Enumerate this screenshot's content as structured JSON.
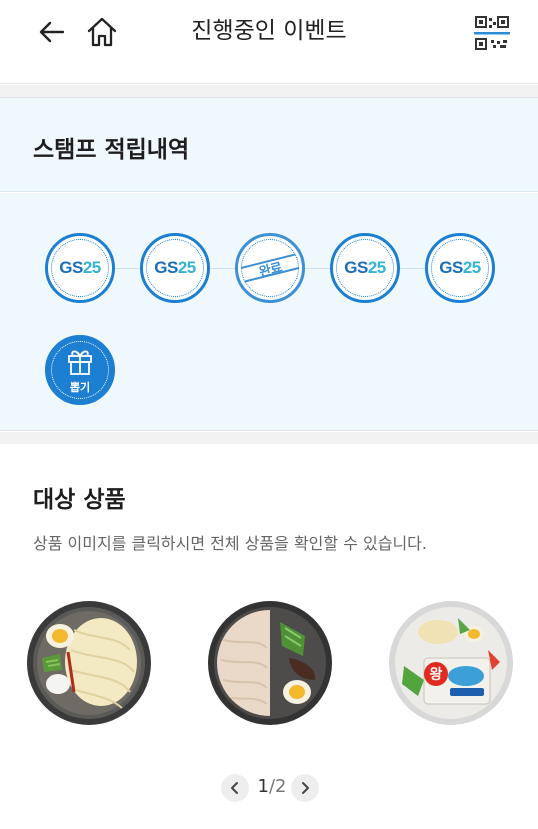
{
  "header": {
    "title": "진행중인 이벤트"
  },
  "stamp_section": {
    "title": "스탬프 적립내역",
    "stamps": [
      {
        "gs": "GS",
        "num": "25"
      },
      {
        "gs": "GS",
        "num": "25"
      },
      {
        "done_label": "완료"
      },
      {
        "gs": "GS",
        "num": "25"
      },
      {
        "gs": "GS",
        "num": "25"
      }
    ],
    "gift_label": "뽑기"
  },
  "products_section": {
    "title": "대상 상품",
    "description": "상품 이미지를 클릭하시면 전체 상품을 확인할 수 있습니다.",
    "product3_badge": "왕"
  },
  "pager": {
    "current": "1",
    "separator": "/",
    "total": "2"
  },
  "colors": {
    "accent": "#1d7fd1",
    "section_bg": "#eef8fd"
  }
}
